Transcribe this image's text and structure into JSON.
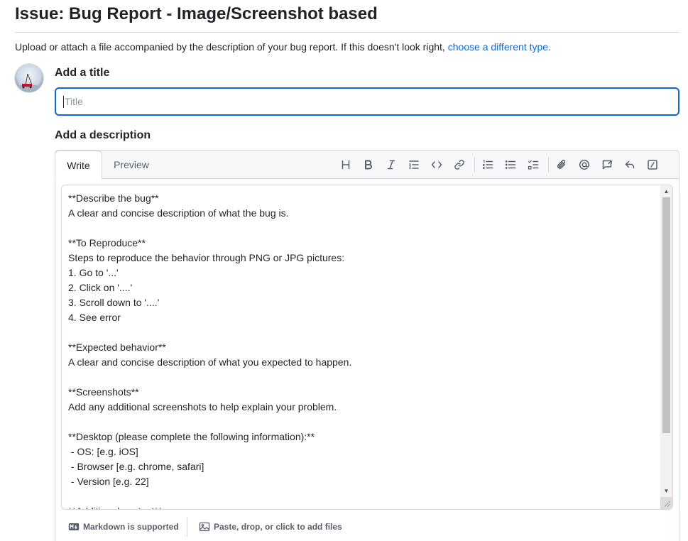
{
  "page": {
    "title": "Issue: Bug Report - Image/Screenshot based",
    "intro_text": "Upload or attach a file accompanied by the description of your bug report. If this doesn't look right,",
    "intro_link": "choose a different type."
  },
  "title_section": {
    "label": "Add a title",
    "placeholder": "Title",
    "value": ""
  },
  "description_section": {
    "label": "Add a description",
    "tabs": {
      "write": "Write",
      "preview": "Preview"
    },
    "toolbar_icons": [
      "heading-icon",
      "bold-icon",
      "italic-icon",
      "quote-icon",
      "code-icon",
      "link-icon",
      "ordered-list-icon",
      "unordered-list-icon",
      "task-list-icon",
      "attach-icon",
      "mention-icon",
      "reference-icon",
      "saved-replies-icon",
      "slash-commands-icon"
    ],
    "body_text": "**Describe the bug**\nA clear and concise description of what the bug is.\n\n**To Reproduce**\nSteps to reproduce the behavior through PNG or JPG pictures:\n1. Go to '...'\n2. Click on '....'\n3. Scroll down to '....'\n4. See error\n\n**Expected behavior**\nA clear and concise description of what you expected to happen.\n\n**Screenshots**\nAdd any additional screenshots to help explain your problem.\n\n**Desktop (please complete the following information):**\n - OS: [e.g. iOS]\n - Browser [e.g. chrome, safari]\n - Version [e.g. 22]\n\n**Additional context**"
  },
  "footer": {
    "markdown_label": "Markdown is supported",
    "files_label": "Paste, drop, or click to add files"
  },
  "colors": {
    "accent": "#0969da",
    "border": "#d0d7de",
    "muted_text": "#57606a"
  }
}
